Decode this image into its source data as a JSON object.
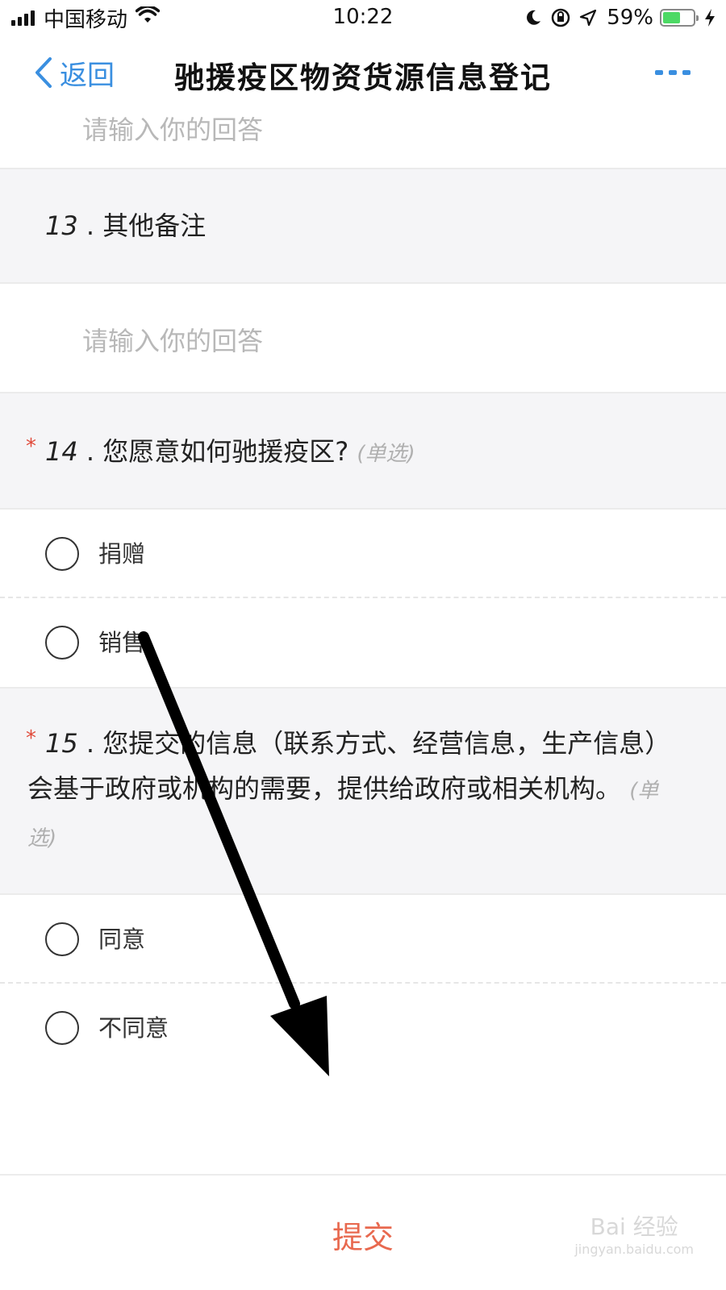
{
  "status_bar": {
    "carrier": "中国移动",
    "time": "10:22",
    "battery_percent": "59%",
    "battery_level": 0.59,
    "icons": [
      "signal-icon",
      "wifi-icon",
      "moon-icon",
      "rotation-lock-icon",
      "location-icon",
      "battery-icon",
      "charging-icon"
    ]
  },
  "nav": {
    "back_label": "返回",
    "title": "驰援疫区物资货源信息登记",
    "more_icon": "more-icon"
  },
  "form": {
    "prev_answer_placeholder": "请输入你的回答",
    "q13": {
      "num": "13",
      "sep": ".",
      "text": "其他备注",
      "placeholder": "请输入你的回答"
    },
    "q14": {
      "required": "*",
      "num": "14",
      "sep": ".",
      "text": "您愿意如何驰援疫区?",
      "hint": "(单选)",
      "options": [
        "捐赠",
        "销售"
      ]
    },
    "q15": {
      "required": "*",
      "num": "15",
      "sep": ".",
      "text": "您提交的信息（联系方式、经营信息，生产信息）会基于政府或机构的需要，提供给政府或相关机构。",
      "hint": "(单选)",
      "options": [
        "同意",
        "不同意"
      ]
    }
  },
  "submit_label": "提交",
  "watermark": {
    "brand": "Bai 经验",
    "url": "jingyan.baidu.com"
  },
  "colors": {
    "accent": "#3a8fe0",
    "submit": "#e8694f",
    "required": "#e04a3a"
  }
}
